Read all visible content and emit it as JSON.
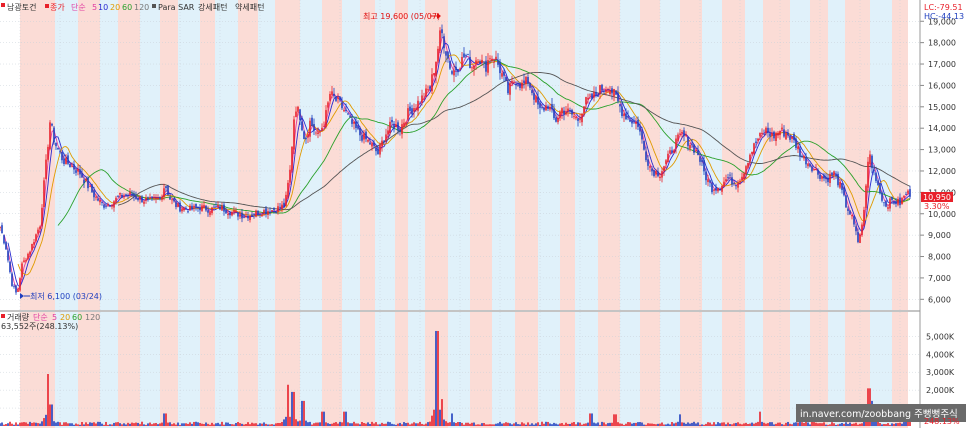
{
  "legend_price": {
    "stock": "남광토건",
    "close_label": "종가",
    "ma_label": "단순",
    "ma_periods": [
      "5",
      "10",
      "20",
      "60",
      "120"
    ],
    "sar": "Para SAR",
    "strong": "강세패턴",
    "weak": "약세패턴"
  },
  "legend_volume": {
    "title": "거래량",
    "ma_label": "단순",
    "ma_periods": [
      "5",
      "20",
      "60",
      "120"
    ],
    "value": "63,552주(248.13%)"
  },
  "corner": {
    "lc": "LC:-79.51",
    "hc": "HC:-44.13"
  },
  "price_tag": {
    "value": "10,950",
    "change": "3.30%"
  },
  "vol_tag": {
    "pct": "248.13%"
  },
  "max_annotation": "최고 19,600 (05/07)",
  "min_annotation": "최저 6,100 (03/24)",
  "watermark": "in.naver.com/zoobbang 주뻥뻥주식",
  "colors": {
    "up": "#e8202a",
    "down": "#1f3fbf",
    "ma5": "#e03ca0",
    "ma10": "#2a2ad0",
    "ma20": "#e09a00",
    "ma60": "#2aa02a",
    "ma120": "#555555",
    "band_red": "#fbdcd6",
    "band_blue": "#e0f1fa"
  },
  "chart_data": {
    "type": "candlestick",
    "price_axis": {
      "ticks": [
        "6,000",
        "7,000",
        "8,000",
        "9,000",
        "10,000",
        "11,000",
        "12,000",
        "13,000",
        "14,000",
        "15,000",
        "16,000",
        "17,000",
        "18,000",
        "19,000"
      ],
      "range": [
        5500,
        19900
      ]
    },
    "volume_axis": {
      "ticks": [
        "1,000K",
        "2,000K",
        "3,000K",
        "4,000K",
        "5,000K"
      ],
      "range": [
        0,
        5800
      ]
    },
    "close_keypoints": [
      [
        0,
        9400
      ],
      [
        6,
        8400
      ],
      [
        12,
        6700
      ],
      [
        17,
        6200
      ],
      [
        22,
        7600
      ],
      [
        30,
        8300
      ],
      [
        40,
        9500
      ],
      [
        47,
        12800
      ],
      [
        50,
        14300
      ],
      [
        55,
        13300
      ],
      [
        63,
        12500
      ],
      [
        70,
        12300
      ],
      [
        80,
        11900
      ],
      [
        88,
        11300
      ],
      [
        95,
        10800
      ],
      [
        103,
        10400
      ],
      [
        110,
        10500
      ],
      [
        120,
        10800
      ],
      [
        130,
        10900
      ],
      [
        140,
        10700
      ],
      [
        150,
        10600
      ],
      [
        160,
        10700
      ],
      [
        165,
        11400
      ],
      [
        170,
        10700
      ],
      [
        178,
        10300
      ],
      [
        190,
        10200
      ],
      [
        200,
        10300
      ],
      [
        210,
        10200
      ],
      [
        220,
        10300
      ],
      [
        230,
        10100
      ],
      [
        245,
        9900
      ],
      [
        260,
        10100
      ],
      [
        275,
        10200
      ],
      [
        285,
        10400
      ],
      [
        290,
        12000
      ],
      [
        295,
        15100
      ],
      [
        300,
        14600
      ],
      [
        305,
        13400
      ],
      [
        310,
        14300
      ],
      [
        318,
        13600
      ],
      [
        325,
        14400
      ],
      [
        330,
        15600
      ],
      [
        340,
        15100
      ],
      [
        345,
        14800
      ],
      [
        350,
        14300
      ],
      [
        360,
        13700
      ],
      [
        370,
        13300
      ],
      [
        378,
        12800
      ],
      [
        385,
        13700
      ],
      [
        392,
        14200
      ],
      [
        400,
        14000
      ],
      [
        408,
        14700
      ],
      [
        416,
        15100
      ],
      [
        424,
        15500
      ],
      [
        430,
        15900
      ],
      [
        436,
        17200
      ],
      [
        441,
        18600
      ],
      [
        446,
        17600
      ],
      [
        452,
        16600
      ],
      [
        458,
        16900
      ],
      [
        465,
        17400
      ],
      [
        472,
        16900
      ],
      [
        478,
        17400
      ],
      [
        485,
        16800
      ],
      [
        490,
        17400
      ],
      [
        496,
        17200
      ],
      [
        502,
        16500
      ],
      [
        508,
        15700
      ],
      [
        515,
        16300
      ],
      [
        522,
        16000
      ],
      [
        528,
        16200
      ],
      [
        535,
        15400
      ],
      [
        540,
        14800
      ],
      [
        548,
        15100
      ],
      [
        555,
        14300
      ],
      [
        562,
        14900
      ],
      [
        570,
        14700
      ],
      [
        578,
        14400
      ],
      [
        585,
        15200
      ],
      [
        592,
        15400
      ],
      [
        600,
        15800
      ],
      [
        608,
        16000
      ],
      [
        615,
        15500
      ],
      [
        622,
        14800
      ],
      [
        630,
        14400
      ],
      [
        638,
        14200
      ],
      [
        645,
        12800
      ],
      [
        652,
        12000
      ],
      [
        660,
        11900
      ],
      [
        668,
        12600
      ],
      [
        675,
        13300
      ],
      [
        682,
        13700
      ],
      [
        690,
        13300
      ],
      [
        698,
        12800
      ],
      [
        705,
        11800
      ],
      [
        712,
        11200
      ],
      [
        720,
        11300
      ],
      [
        728,
        11700
      ],
      [
        735,
        11400
      ],
      [
        742,
        11800
      ],
      [
        750,
        12800
      ],
      [
        758,
        13500
      ],
      [
        766,
        13900
      ],
      [
        773,
        13600
      ],
      [
        780,
        13900
      ],
      [
        788,
        13700
      ],
      [
        795,
        13300
      ],
      [
        802,
        12700
      ],
      [
        810,
        12300
      ],
      [
        818,
        11900
      ],
      [
        826,
        11600
      ],
      [
        834,
        11900
      ],
      [
        840,
        11300
      ],
      [
        846,
        10400
      ],
      [
        852,
        9800
      ],
      [
        858,
        8700
      ],
      [
        862,
        9400
      ],
      [
        866,
        11200
      ],
      [
        869,
        13000
      ],
      [
        872,
        12200
      ],
      [
        876,
        11700
      ],
      [
        880,
        11000
      ],
      [
        885,
        10400
      ],
      [
        892,
        10600
      ],
      [
        900,
        10500
      ],
      [
        906,
        10950
      ]
    ],
    "volume_spikes": [
      [
        48,
        2900
      ],
      [
        51,
        1200
      ],
      [
        165,
        700
      ],
      [
        288,
        2300
      ],
      [
        293,
        1900
      ],
      [
        303,
        1400
      ],
      [
        323,
        800
      ],
      [
        345,
        800
      ],
      [
        437,
        5300
      ],
      [
        442,
        1500
      ],
      [
        452,
        700
      ],
      [
        591,
        700
      ],
      [
        615,
        650
      ],
      [
        680,
        650
      ],
      [
        760,
        800
      ],
      [
        869,
        2100
      ],
      [
        872,
        1400
      ],
      [
        908,
        800
      ]
    ],
    "bands": [
      [
        20,
        55,
        "red"
      ],
      [
        55,
        78,
        "blue"
      ],
      [
        78,
        100,
        "red"
      ],
      [
        100,
        118,
        "blue"
      ],
      [
        118,
        140,
        "red"
      ],
      [
        140,
        160,
        "blue"
      ],
      [
        160,
        178,
        "red"
      ],
      [
        178,
        200,
        "blue"
      ],
      [
        200,
        215,
        "red"
      ],
      [
        215,
        238,
        "blue"
      ],
      [
        238,
        258,
        "red"
      ],
      [
        258,
        275,
        "blue"
      ],
      [
        275,
        300,
        "red"
      ],
      [
        300,
        322,
        "blue"
      ],
      [
        322,
        342,
        "red"
      ],
      [
        342,
        360,
        "blue"
      ],
      [
        360,
        375,
        "red"
      ],
      [
        375,
        395,
        "blue"
      ],
      [
        395,
        408,
        "red"
      ],
      [
        408,
        425,
        "blue"
      ],
      [
        425,
        448,
        "red"
      ],
      [
        448,
        470,
        "blue"
      ],
      [
        470,
        492,
        "red"
      ],
      [
        492,
        515,
        "blue"
      ],
      [
        515,
        538,
        "red"
      ],
      [
        538,
        560,
        "blue"
      ],
      [
        560,
        575,
        "red"
      ],
      [
        575,
        598,
        "blue"
      ],
      [
        598,
        620,
        "red"
      ],
      [
        620,
        640,
        "blue"
      ],
      [
        640,
        660,
        "red"
      ],
      [
        660,
        680,
        "blue"
      ],
      [
        680,
        702,
        "red"
      ],
      [
        702,
        722,
        "blue"
      ],
      [
        722,
        745,
        "red"
      ],
      [
        745,
        763,
        "blue"
      ],
      [
        763,
        790,
        "red"
      ],
      [
        790,
        810,
        "blue"
      ],
      [
        810,
        828,
        "red"
      ],
      [
        828,
        845,
        "blue"
      ],
      [
        845,
        870,
        "red"
      ],
      [
        870,
        892,
        "blue"
      ],
      [
        892,
        908,
        "red"
      ]
    ]
  }
}
